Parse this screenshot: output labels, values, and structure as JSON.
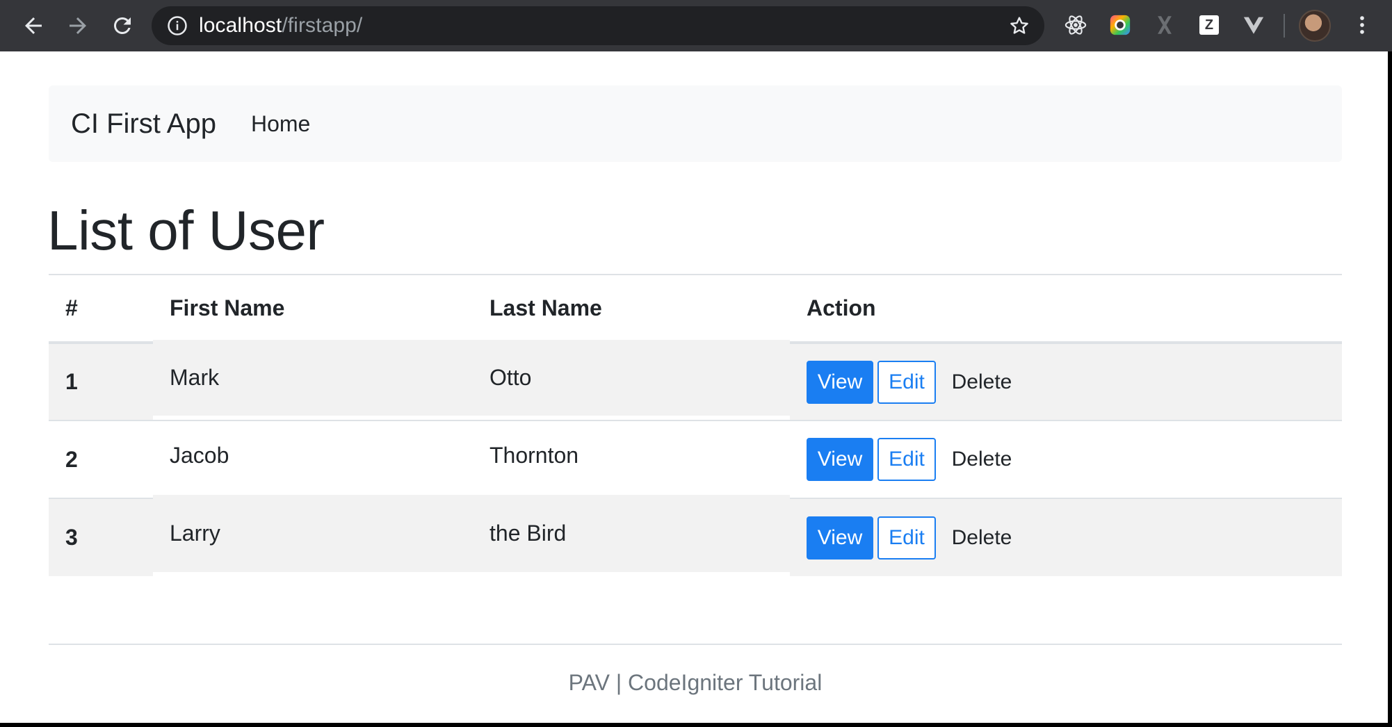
{
  "browser": {
    "url_host": "localhost",
    "url_path": "/firstapp/",
    "icons": {
      "back": "back-arrow-icon",
      "forward": "forward-arrow-icon",
      "reload": "reload-icon",
      "info": "info-icon",
      "bookmark": "star-icon",
      "ext_react": "react-devtools-icon",
      "ext_color": "color-picker-icon",
      "ext_x": "x-extension-icon",
      "ext_z": "z-extension-icon",
      "ext_vue": "vue-devtools-icon",
      "menu": "kebab-menu-icon"
    },
    "ext_z_letter": "Z"
  },
  "navbar": {
    "brand": "CI First App",
    "links": [
      "Home"
    ]
  },
  "main": {
    "title": "List of User",
    "table": {
      "headers": [
        "#",
        "First Name",
        "Last Name",
        "Action"
      ],
      "rows": [
        {
          "id": "1",
          "first": "Mark",
          "last": "Otto"
        },
        {
          "id": "2",
          "first": "Jacob",
          "last": "Thornton"
        },
        {
          "id": "3",
          "first": "Larry",
          "last": "the Bird"
        }
      ],
      "actions": {
        "view": "View",
        "edit": "Edit",
        "delete": "Delete"
      }
    }
  },
  "footer": {
    "text": "PAV | CodeIgniter Tutorial"
  },
  "colors": {
    "primary": "#1a7ef2",
    "chrome": "#35363a",
    "omnibox": "#202124",
    "navbar_bg": "#f8f9fa",
    "striped_row": "#f2f2f2",
    "footer_text": "#6c757d"
  }
}
